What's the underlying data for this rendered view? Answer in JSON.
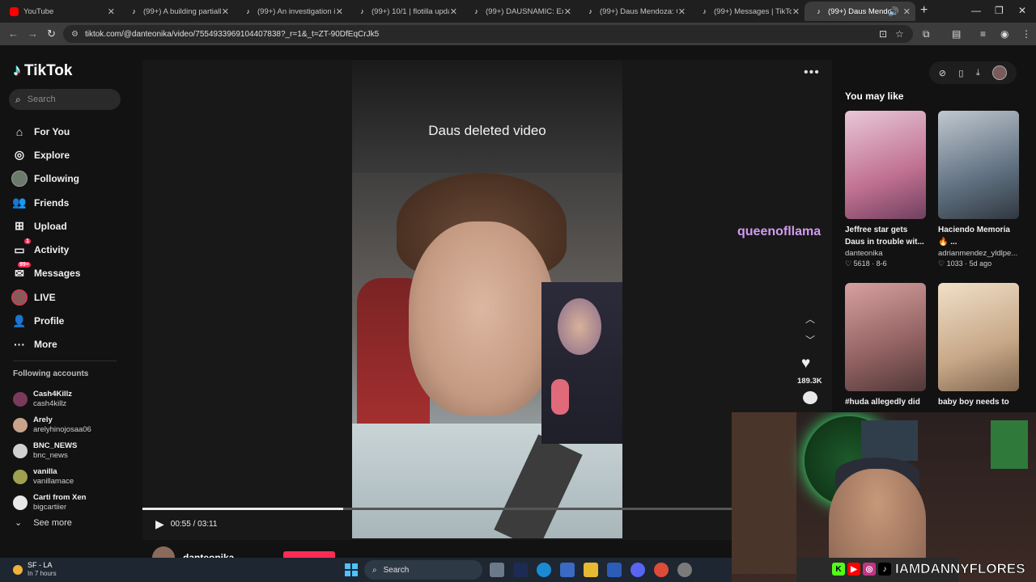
{
  "browser": {
    "tabs": [
      {
        "title": "YouTube",
        "icon": "youtube-icon"
      },
      {
        "title": "(99+) A building partially c",
        "icon": "tiktok-icon"
      },
      {
        "title": "(99+) An investigation is u",
        "icon": "tiktok-icon"
      },
      {
        "title": "(99+) 10/1 | flotilla update",
        "icon": "tiktok-icon"
      },
      {
        "title": "(99+) DAUSNAMIC: Explor",
        "icon": "tiktok-icon"
      },
      {
        "title": "(99+) Daus Mendoza: Grow",
        "icon": "tiktok-icon"
      },
      {
        "title": "(99+) Messages | TikTok",
        "icon": "tiktok-icon"
      },
      {
        "title": "(99+) Daus Mendoza (",
        "icon": "tiktok-icon",
        "active": true
      }
    ],
    "url": "tiktok.com/@danteonika/video/7554933969104407838?_r=1&_t=ZT-90DfEqCrJk5"
  },
  "sidebar": {
    "logo": "TikTok",
    "search_placeholder": "Search",
    "items": [
      {
        "label": "For You",
        "icon": "home-icon"
      },
      {
        "label": "Explore",
        "icon": "compass-icon"
      },
      {
        "label": "Following",
        "icon": "following-avatar-icon"
      },
      {
        "label": "Friends",
        "icon": "friends-icon"
      },
      {
        "label": "Upload",
        "icon": "upload-icon"
      },
      {
        "label": "Activity",
        "icon": "activity-icon",
        "badge": "1"
      },
      {
        "label": "Messages",
        "icon": "messages-icon",
        "badge": "99+"
      },
      {
        "label": "LIVE",
        "icon": "live-icon"
      },
      {
        "label": "Profile",
        "icon": "profile-icon"
      },
      {
        "label": "More",
        "icon": "more-icon"
      }
    ],
    "following_heading": "Following accounts",
    "following": [
      {
        "name": "Cash4Killz",
        "handle": "cash4killz",
        "color": "#7a3a5a"
      },
      {
        "name": "Arely",
        "handle": "arelyhinojosaa06",
        "color": "#c9a48a"
      },
      {
        "name": "BNC_NEWS",
        "handle": "bnc_news",
        "color": "#d0d0d0"
      },
      {
        "name": "vanilla",
        "handle": "vanillamace",
        "color": "#a0a050"
      },
      {
        "name": "Carti from Xen",
        "handle": "bigcartiier",
        "color": "#e8e8e8"
      }
    ],
    "see_more": "See more"
  },
  "video": {
    "caption": "Daus deleted video",
    "time": "00:55 / 03:11",
    "progress": 0.34,
    "likes": "189.3K",
    "author": "danteonika",
    "overlay_name": "queenofllama"
  },
  "you_may_like": {
    "heading": "You may like",
    "items": [
      {
        "title": "Jeffree star gets Daus in trouble wit...",
        "author": "danteonika",
        "meta": "♡ 5618 · 8-6",
        "thumb": "#d0a0c0"
      },
      {
        "title": "Haciendo Memoria 🔥 ...",
        "author": "adrianmendez_yldlpe...",
        "meta": "♡ 1033 · 5d ago",
        "thumb": "#8090a0"
      },
      {
        "title": "#huda allegedly did",
        "author": "",
        "meta": "",
        "thumb": "#b07070"
      },
      {
        "title": "baby boy needs to",
        "author": "",
        "meta": "",
        "thumb": "#d8c0a8"
      }
    ]
  },
  "stream": {
    "handle": "IAMDANNYFLORES"
  },
  "taskbar": {
    "weather_title": "SF - LA",
    "weather_sub": "In 7 hours",
    "search_label": "Search"
  }
}
